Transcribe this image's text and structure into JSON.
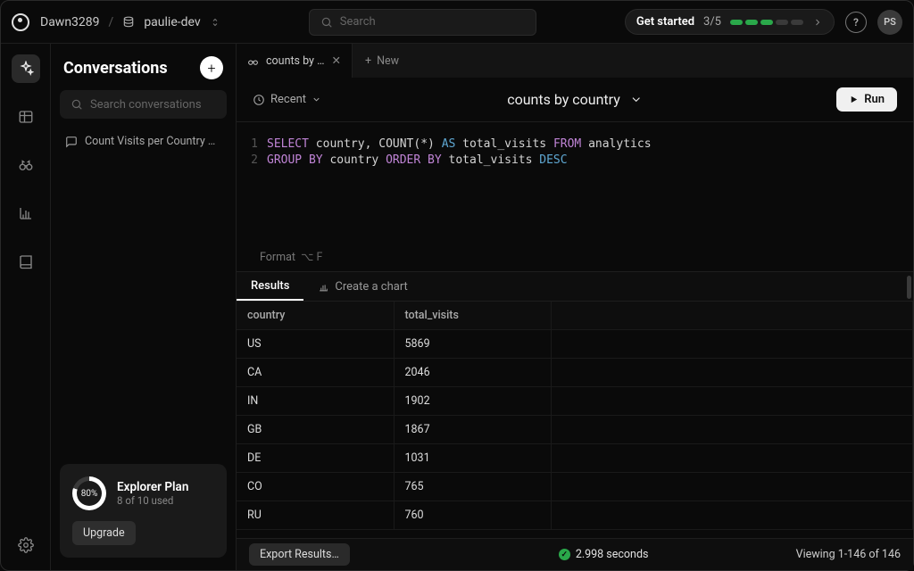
{
  "header": {
    "workspace": "Dawn3289",
    "project": "paulie-dev",
    "search_placeholder": "Search",
    "get_started": {
      "label": "Get started",
      "progress": "3/5",
      "completed": 3,
      "total": 5
    },
    "avatar_initials": "PS"
  },
  "iconbar": {
    "items": [
      "sparkles",
      "table",
      "binoculars",
      "chart",
      "book"
    ],
    "bottom": "settings"
  },
  "sidebar": {
    "title": "Conversations",
    "search_placeholder": "Search conversations",
    "items": [
      {
        "label": "Count Visits per Country …"
      }
    ],
    "plan": {
      "name": "Explorer Plan",
      "usage_text": "8 of 10 used",
      "percent_label": "80%",
      "percent": 80,
      "upgrade_label": "Upgrade"
    }
  },
  "tabs": {
    "open": [
      {
        "label": "counts by count"
      }
    ],
    "new_label": "New"
  },
  "toolbar": {
    "recent_label": "Recent",
    "title": "counts by country",
    "run_label": "Run"
  },
  "editor": {
    "lines": [
      {
        "n": "1",
        "tokens": [
          {
            "t": "SELECT",
            "c": "kw"
          },
          {
            "t": " country, ",
            "c": "id"
          },
          {
            "t": "COUNT",
            "c": "id"
          },
          {
            "t": "(*) ",
            "c": "id"
          },
          {
            "t": "AS",
            "c": "kw2"
          },
          {
            "t": " total_visits ",
            "c": "id"
          },
          {
            "t": "FROM",
            "c": "kw"
          },
          {
            "t": " analytics",
            "c": "id"
          }
        ]
      },
      {
        "n": "2",
        "tokens": [
          {
            "t": "GROUP BY",
            "c": "kw"
          },
          {
            "t": " country ",
            "c": "id"
          },
          {
            "t": "ORDER BY",
            "c": "kw"
          },
          {
            "t": " total_visits ",
            "c": "id"
          },
          {
            "t": "DESC",
            "c": "kw2"
          }
        ]
      }
    ],
    "format_label": "Format",
    "format_keys": "⌥ F"
  },
  "results": {
    "tabs": {
      "results": "Results",
      "chart": "Create a chart"
    },
    "columns": [
      "country",
      "total_visits"
    ],
    "rows": [
      [
        "US",
        "5869"
      ],
      [
        "CA",
        "2046"
      ],
      [
        "IN",
        "1902"
      ],
      [
        "GB",
        "1867"
      ],
      [
        "DE",
        "1031"
      ],
      [
        "CO",
        "765"
      ],
      [
        "RU",
        "760"
      ]
    ],
    "export_label": "Export Results…",
    "time": "2.998 seconds",
    "viewing": "Viewing 1-146 of 146"
  }
}
